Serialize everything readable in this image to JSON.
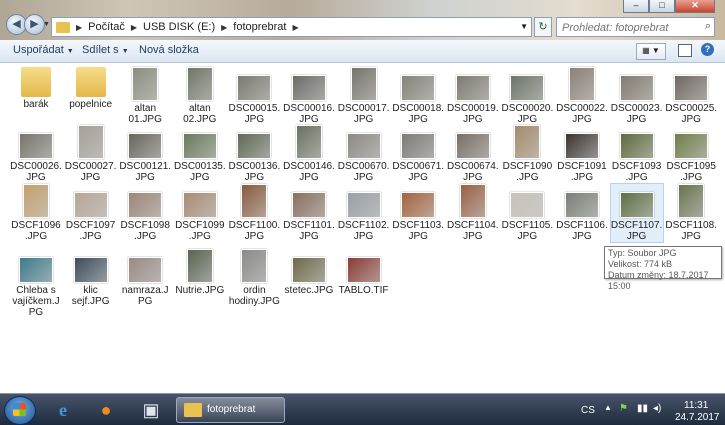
{
  "address": {
    "crumbs": [
      "Počítač",
      "USB DISK (E:)",
      "fotoprebrat"
    ]
  },
  "search": {
    "placeholder": "Prohledat: fotoprebrat"
  },
  "toolbar": {
    "organize": "Uspořádat",
    "share": "Sdílet s",
    "new_folder": "Nová složka"
  },
  "files": [
    {
      "name": "barák",
      "kind": "folder"
    },
    {
      "name": "popelnice",
      "kind": "folder"
    },
    {
      "name": "altan 01.JPG",
      "kind": "photo",
      "color": "#8a8e7e"
    },
    {
      "name": "altan 02.JPG",
      "kind": "photo",
      "color": "#6f7766"
    },
    {
      "name": "DSC00015.JPG",
      "kind": "photo",
      "color": "#7b7a70"
    },
    {
      "name": "DSC00016.JPG",
      "kind": "photo",
      "color": "#6d6d67"
    },
    {
      "name": "DSC00017.JPG",
      "kind": "photo",
      "color": "#76746b"
    },
    {
      "name": "DSC00018.JPG",
      "kind": "photo",
      "color": "#858479"
    },
    {
      "name": "DSC00019.JPG",
      "kind": "photo",
      "color": "#7d7b70"
    },
    {
      "name": "DSC00020.JPG",
      "kind": "photo",
      "color": "#6d7569"
    },
    {
      "name": "DSC00022.JPG",
      "kind": "photo",
      "color": "#8b8176"
    },
    {
      "name": "DSC00023.JPG",
      "kind": "photo",
      "color": "#817a6f"
    },
    {
      "name": "DSC00025.JPG",
      "kind": "photo",
      "color": "#6f685f"
    },
    {
      "name": "DSC00026.JPG",
      "kind": "photo",
      "color": "#77756c"
    },
    {
      "name": "DSC00027.JPG",
      "kind": "photo",
      "color": "#a5a097"
    },
    {
      "name": "DSC00121.JPG",
      "kind": "photo",
      "color": "#6a665d"
    },
    {
      "name": "DSC00135.JPG",
      "kind": "photo",
      "color": "#6b7a5c"
    },
    {
      "name": "DSC00136.JPG",
      "kind": "photo",
      "color": "#5f6a55"
    },
    {
      "name": "DSC00146.JPG",
      "kind": "photo",
      "color": "#6a7260"
    },
    {
      "name": "DSC00670.JPG",
      "kind": "photo",
      "color": "#8d8a84"
    },
    {
      "name": "DSC00671.JPG",
      "kind": "photo",
      "color": "#7c7a76"
    },
    {
      "name": "DSC00674.JPG",
      "kind": "photo",
      "color": "#7a6f66"
    },
    {
      "name": "DSCF1090.JPG",
      "kind": "photo",
      "color": "#a58b6a"
    },
    {
      "name": "DSCF1091.JPG",
      "kind": "photo",
      "color": "#3b3431"
    },
    {
      "name": "DSCF1093.JPG",
      "kind": "photo",
      "color": "#5e6a3c"
    },
    {
      "name": "DSCF1095.JPG",
      "kind": "photo",
      "color": "#6f7e4b"
    },
    {
      "name": "DSCF1096.JPG",
      "kind": "photo",
      "color": "#c3a06e"
    },
    {
      "name": "DSCF1097.JPG",
      "kind": "photo",
      "color": "#b7a796"
    },
    {
      "name": "DSCF1098.JPG",
      "kind": "photo",
      "color": "#9c8778"
    },
    {
      "name": "DSCF1099.JPG",
      "kind": "photo",
      "color": "#a98c73"
    },
    {
      "name": "DSCF1100.JPG",
      "kind": "photo",
      "color": "#8b5a3e"
    },
    {
      "name": "DSCF1101.JPG",
      "kind": "photo",
      "color": "#8a6f5d"
    },
    {
      "name": "DSCF1102.JPG",
      "kind": "photo",
      "color": "#9aa0a6"
    },
    {
      "name": "DSCF1103.JPG",
      "kind": "photo",
      "color": "#a5643f"
    },
    {
      "name": "DSCF1104.JPG",
      "kind": "photo",
      "color": "#9a6046"
    },
    {
      "name": "DSCF1105.JPG",
      "kind": "photo",
      "color": "#c8c3b8"
    },
    {
      "name": "DSCF1106.JPG",
      "kind": "photo",
      "color": "#7c8077"
    },
    {
      "name": "DSCF1107.JPG",
      "kind": "photo",
      "color": "#5e7047",
      "selected": true
    },
    {
      "name": "DSCF1108.JPG",
      "kind": "photo",
      "color": "#6a7450"
    },
    {
      "name": "Chleba s vajíčkem.JPG",
      "kind": "photo",
      "color": "#3f7a8a"
    },
    {
      "name": "klic sejf.JPG",
      "kind": "photo",
      "color": "#3e4c5a"
    },
    {
      "name": "namraza.JPG",
      "kind": "photo",
      "color": "#9a8a84"
    },
    {
      "name": "Nutrie.JPG",
      "kind": "photo",
      "color": "#59634f"
    },
    {
      "name": "ordin hodiny.JPG",
      "kind": "photo",
      "color": "#8a8a88"
    },
    {
      "name": "stetec.JPG",
      "kind": "photo",
      "color": "#6e6a4a"
    },
    {
      "name": "TABLO.TIF",
      "kind": "photo",
      "color": "#8a3c34"
    }
  ],
  "tooltip": {
    "type": "Typ: Soubor JPG",
    "size": "Velikost: 774 kB",
    "date": "Datum změny: 18.7.2017 15:00"
  },
  "taskbar": {
    "active_window": "fotoprebrat",
    "language": "CS",
    "time": "11:31",
    "date": "24.7.2017"
  }
}
